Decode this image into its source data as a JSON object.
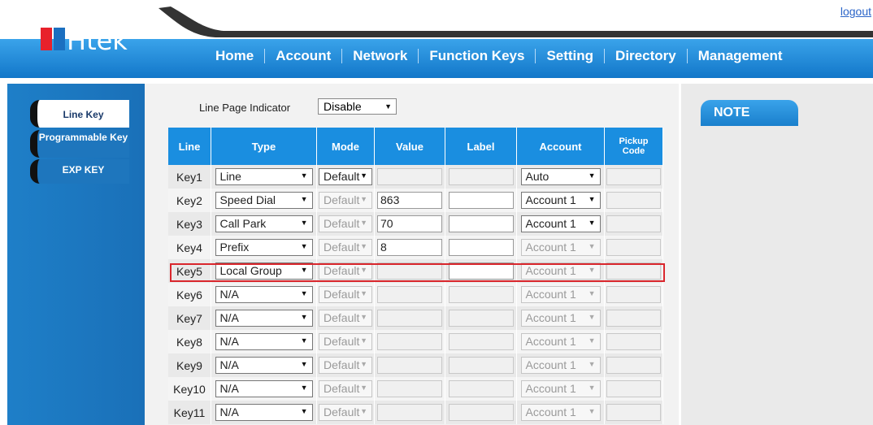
{
  "header": {
    "logout": "logout",
    "logo_text": "Htek",
    "nav": [
      "Home",
      "Account",
      "Network",
      "Function Keys",
      "Setting",
      "Directory",
      "Management"
    ]
  },
  "sidebar": {
    "items": [
      {
        "label": "Line Key",
        "active": true
      },
      {
        "label": "Programmable Key",
        "active": false
      },
      {
        "label": "EXP KEY",
        "active": false
      }
    ]
  },
  "line_page_indicator": {
    "label": "Line Page Indicator",
    "value": "Disable"
  },
  "table": {
    "headers": [
      "Line",
      "Type",
      "Mode",
      "Value",
      "Label",
      "Account",
      "Pickup Code"
    ],
    "rows": [
      {
        "line": "Key1",
        "type": "Line",
        "mode": "Default",
        "value": "",
        "account": "Auto"
      },
      {
        "line": "Key2",
        "type": "Speed Dial",
        "mode": "Default",
        "value": "863",
        "account": "Account 1"
      },
      {
        "line": "Key3",
        "type": "Call Park",
        "mode": "Default",
        "value": "70",
        "account": "Account 1"
      },
      {
        "line": "Key4",
        "type": "Prefix",
        "mode": "Default",
        "value": "8",
        "account": "Account 1"
      },
      {
        "line": "Key5",
        "type": "Local Group",
        "mode": "Default",
        "value": "",
        "account": "Account 1"
      },
      {
        "line": "Key6",
        "type": "N/A",
        "mode": "Default",
        "value": "",
        "account": "Account 1"
      },
      {
        "line": "Key7",
        "type": "N/A",
        "mode": "Default",
        "value": "",
        "account": "Account 1"
      },
      {
        "line": "Key8",
        "type": "N/A",
        "mode": "Default",
        "value": "",
        "account": "Account 1"
      },
      {
        "line": "Key9",
        "type": "N/A",
        "mode": "Default",
        "value": "",
        "account": "Account 1"
      },
      {
        "line": "Key10",
        "type": "N/A",
        "mode": "Default",
        "value": "",
        "account": "Account 1"
      },
      {
        "line": "Key11",
        "type": "N/A",
        "mode": "Default",
        "value": "",
        "account": "Account 1"
      }
    ]
  },
  "note": {
    "title": "NOTE"
  },
  "colors": {
    "nav_blue": "#1a8ee0",
    "highlight_red": "#d9262c",
    "logo_red": "#e8212b",
    "logo_blue": "#1b6fc0"
  }
}
